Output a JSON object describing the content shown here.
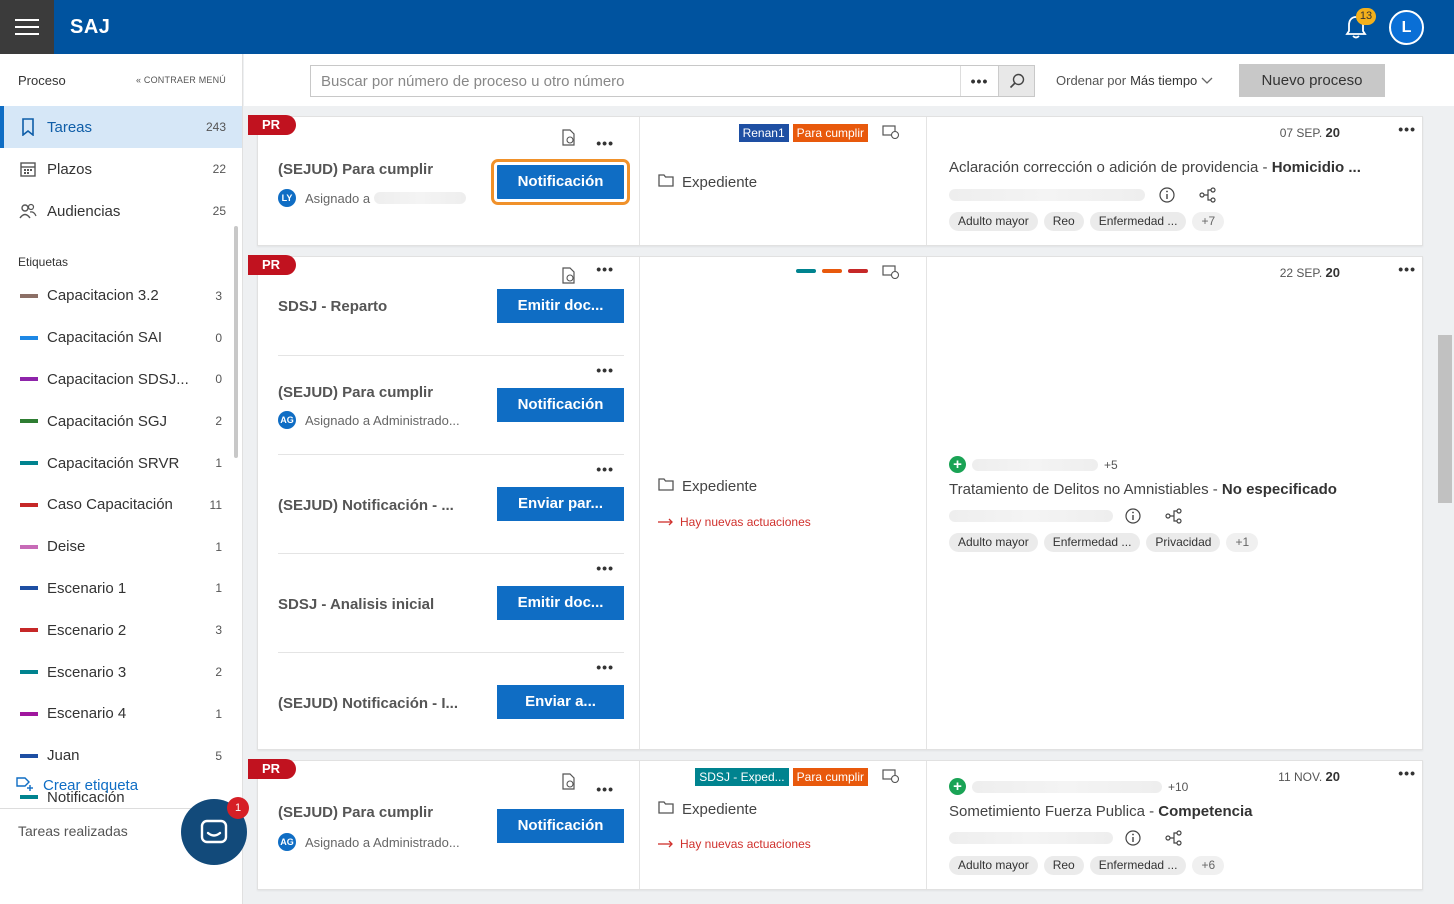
{
  "app": {
    "brand": "SAJ",
    "notifications": "13",
    "user_initial": "L"
  },
  "sidebar": {
    "title": "Proceso",
    "collapse_label": "CONTRAER MENÚ",
    "nav": [
      {
        "label": "Tareas",
        "count": "243",
        "icon": "bookmark-icon"
      },
      {
        "label": "Plazos",
        "count": "22",
        "icon": "calendar-icon"
      },
      {
        "label": "Audiencias",
        "count": "25",
        "icon": "people-icon"
      }
    ],
    "tags_title": "Etiquetas",
    "tags": [
      {
        "label": "Capacitacion 3.2",
        "count": "3",
        "color": "#8c6f66"
      },
      {
        "label": "Capacitación SAI",
        "count": "0",
        "color": "#1e88e5"
      },
      {
        "label": "Capacitacion SDSJ...",
        "count": "0",
        "color": "#8e24aa"
      },
      {
        "label": "Capacitación SGJ",
        "count": "2",
        "color": "#2e7d32"
      },
      {
        "label": "Capacitación SRVR",
        "count": "1",
        "color": "#00838f"
      },
      {
        "label": "Caso Capacitación",
        "count": "11",
        "color": "#c62828"
      },
      {
        "label": "Deise",
        "count": "1",
        "color": "#c76bb7"
      },
      {
        "label": "Escenario 1",
        "count": "1",
        "color": "#1e4fa3"
      },
      {
        "label": "Escenario 2",
        "count": "3",
        "color": "#c62828"
      },
      {
        "label": "Escenario 3",
        "count": "2",
        "color": "#00838f"
      },
      {
        "label": "Escenario 4",
        "count": "1",
        "color": "#a0169e"
      },
      {
        "label": "Juan",
        "count": "5",
        "color": "#1e4fa3"
      },
      {
        "label": "Notificación",
        "count": "",
        "color": "#00838f"
      }
    ],
    "create_tag": "Crear etiqueta",
    "done_tasks": "Tareas realizadas",
    "chat_badge": "1"
  },
  "toolbar": {
    "search_placeholder": "Buscar por número de proceso u otro número",
    "more": "•••",
    "sort_prefix": "Ordenar por",
    "sort_value": "Más tiempo",
    "new_button": "Nuevo proceso"
  },
  "cards": [
    {
      "badge": "PR",
      "tasks": [
        {
          "name": "(SEJUD) Para cumplir",
          "avatar": "LY",
          "assigned": "Asignado a",
          "action": "Notificación"
        }
      ],
      "chips": [
        {
          "label": "Renan1",
          "color": "#1e4fa3"
        },
        {
          "label": "Para cumplir",
          "color": "#e8590c"
        }
      ],
      "expediente": "Expediente",
      "date_day": "07 SEP.",
      "date_year": "20",
      "title": "Aclaración corrección o adición de providencia",
      "title_bold": "Homicidio ...",
      "pills": [
        "Adulto mayor",
        "Reo",
        "Enfermedad ...",
        "+7"
      ]
    },
    {
      "badge": "PR",
      "tasks": [
        {
          "name": "SDSJ - Reparto",
          "avatar": "",
          "assigned": "",
          "action": "Emitir doc..."
        },
        {
          "name": "(SEJUD) Para cumplir",
          "avatar": "AG",
          "assigned": "Asignado a Administrado...",
          "action": "Notificación"
        },
        {
          "name": "(SEJUD) Notificación - ...",
          "avatar": "",
          "assigned": "",
          "action": "Enviar par..."
        },
        {
          "name": "SDSJ - Analisis inicial",
          "avatar": "",
          "assigned": "",
          "action": "Emitir doc..."
        },
        {
          "name": "(SEJUD) Notificación - I...",
          "avatar": "",
          "assigned": "",
          "action": "Enviar a..."
        }
      ],
      "dash_colors": [
        "#00838f",
        "#e8590c",
        "#c62828"
      ],
      "expediente": "Expediente",
      "news": "Hay nuevas actuaciones",
      "date_day": "22 SEP.",
      "date_year": "20",
      "plus_count": "+5",
      "title": "Tratamiento de Delitos no Amnistiables",
      "title_bold": "No especificado",
      "pills": [
        "Adulto mayor",
        "Enfermedad ...",
        "Privacidad",
        "+1"
      ]
    },
    {
      "badge": "PR",
      "tasks": [
        {
          "name": "(SEJUD) Para cumplir",
          "avatar": "AG",
          "assigned": "Asignado a Administrado...",
          "action": "Notificación"
        }
      ],
      "chips": [
        {
          "label": "SDSJ - Exped...",
          "color": "#00838f"
        },
        {
          "label": "Para cumplir",
          "color": "#e8590c"
        }
      ],
      "expediente": "Expediente",
      "news": "Hay nuevas actuaciones",
      "date_day": "11 NOV.",
      "date_year": "20",
      "plus_count": "+10",
      "title": "Sometimiento Fuerza Publica",
      "title_bold": "Competencia",
      "pills": [
        "Adulto mayor",
        "Reo",
        "Enfermedad ...",
        "+6"
      ]
    }
  ]
}
